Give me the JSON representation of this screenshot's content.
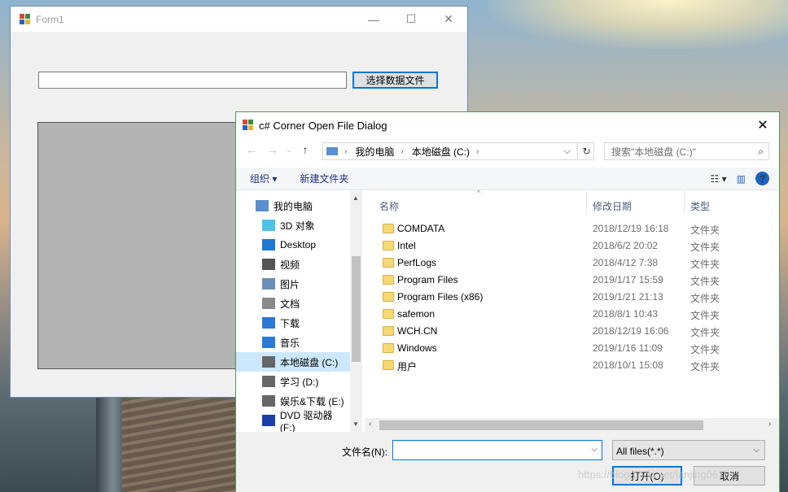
{
  "form1": {
    "title": "Form1",
    "select_button": "选择数据文件",
    "path_value": ""
  },
  "dialog": {
    "title": "c# Corner Open File Dialog",
    "address": {
      "crumbs": [
        "我的电脑",
        "本地磁盘 (C:)"
      ]
    },
    "search_placeholder": "搜索\"本地磁盘 (C:)\"",
    "toolbar": {
      "organize": "组织",
      "new_folder": "新建文件夹"
    },
    "nav_items": [
      {
        "label": "我的电脑",
        "icon": "computer-icon"
      },
      {
        "label": "3D 对象",
        "icon": "cube-icon"
      },
      {
        "label": "Desktop",
        "icon": "desktop-icon"
      },
      {
        "label": "视频",
        "icon": "video-icon"
      },
      {
        "label": "图片",
        "icon": "picture-icon"
      },
      {
        "label": "文档",
        "icon": "document-icon"
      },
      {
        "label": "下载",
        "icon": "download-icon"
      },
      {
        "label": "音乐",
        "icon": "music-icon"
      },
      {
        "label": "本地磁盘 (C:)",
        "icon": "drive-icon",
        "selected": true
      },
      {
        "label": "学习 (D:)",
        "icon": "drive-icon"
      },
      {
        "label": "娱乐&下载 (E:)",
        "icon": "drive-icon"
      },
      {
        "label": "DVD 驱动器 (F:)",
        "icon": "dvd-icon"
      }
    ],
    "columns": {
      "name": "名称",
      "date": "修改日期",
      "type": "类型"
    },
    "files": [
      {
        "name": "COMDATA",
        "date": "2018/12/19 16:18",
        "type": "文件夹"
      },
      {
        "name": "Intel",
        "date": "2018/6/2 20:02",
        "type": "文件夹"
      },
      {
        "name": "PerfLogs",
        "date": "2018/4/12 7:38",
        "type": "文件夹"
      },
      {
        "name": "Program Files",
        "date": "2019/1/17 15:59",
        "type": "文件夹"
      },
      {
        "name": "Program Files (x86)",
        "date": "2019/1/21 21:13",
        "type": "文件夹"
      },
      {
        "name": "safemon",
        "date": "2018/8/1 10:43",
        "type": "文件夹"
      },
      {
        "name": "WCH.CN",
        "date": "2018/12/19 16:06",
        "type": "文件夹"
      },
      {
        "name": "Windows",
        "date": "2019/1/16 11:09",
        "type": "文件夹"
      },
      {
        "name": "用户",
        "date": "2018/10/1 15:08",
        "type": "文件夹"
      }
    ],
    "filename_label": "文件名(N):",
    "filename_value": "",
    "filter_value": "All files(*.*)",
    "open_button": "打开(O)",
    "cancel_button": "取消"
  },
  "watermark": "https://blog.csdn.net/lanjing0615"
}
